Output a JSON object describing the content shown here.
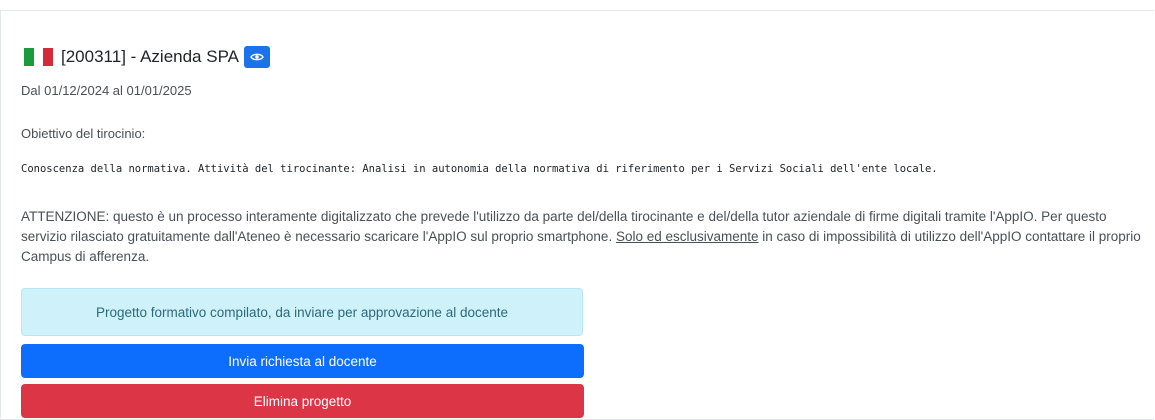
{
  "header": {
    "title": "[200311] - Azienda SPA",
    "view_icon": "eye-icon",
    "flag": "italian-flag-icon"
  },
  "period": {
    "text": "Dal 01/12/2024 al 01/01/2025"
  },
  "objective": {
    "label": "Obiettivo del tirocinio:",
    "text": "Conoscenza della normativa. Attività del tirocinante: Analisi in autonomia della normativa di riferimento per i Servizi Sociali dell'ente locale."
  },
  "notice": {
    "part1": "ATTENZIONE: questo è un processo interamente digitalizzato che prevede l'utilizzo da parte del/della tirocinante e del/della tutor aziendale di firme digitali tramite l'AppIO. Per questo servizio rilasciato gratuitamente dall'Ateneo è necessario scaricare l'AppIO sul proprio smartphone. ",
    "underlined": "Solo ed esclusivamente",
    "part2": " in caso di impossibilità di utilizzo dell'AppIO contattare il proprio Campus di afferenza."
  },
  "status": {
    "text": "Progetto formativo compilato, da inviare per approvazione al docente"
  },
  "actions": {
    "send_label": "Invia richiesta al docente",
    "delete_label": "Elimina progetto"
  },
  "colors": {
    "primary": "#0d6efd",
    "danger": "#dc3545",
    "info_bg": "#cff1f9",
    "flag_green": "#1a9c3e",
    "flag_red": "#d42b3a"
  }
}
